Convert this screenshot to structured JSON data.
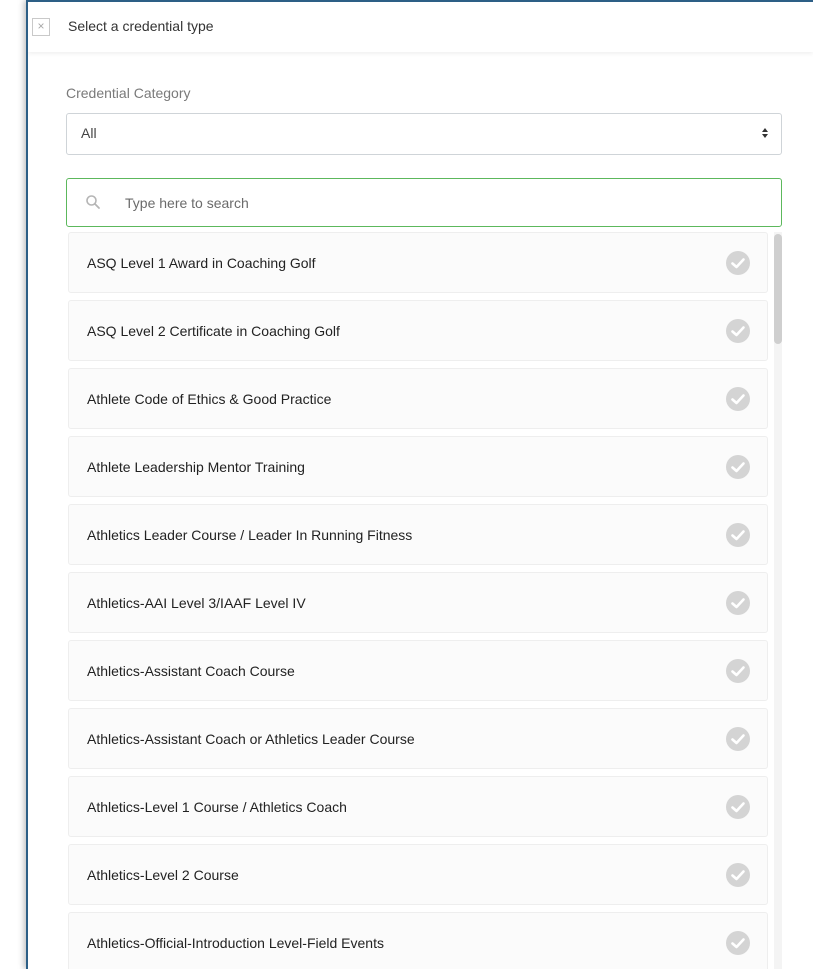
{
  "header": {
    "title": "Select a credential type",
    "close_glyph": "×"
  },
  "category": {
    "label": "Credential Category",
    "selected": "All"
  },
  "search": {
    "placeholder": "Type here to search",
    "value": ""
  },
  "items": [
    {
      "label": "ASQ Level 1 Award in Coaching Golf"
    },
    {
      "label": "ASQ Level 2 Certificate in Coaching Golf"
    },
    {
      "label": "Athlete Code of Ethics & Good Practice"
    },
    {
      "label": "Athlete Leadership Mentor Training"
    },
    {
      "label": "Athletics Leader Course / Leader In Running Fitness"
    },
    {
      "label": "Athletics-AAI Level 3/IAAF Level IV"
    },
    {
      "label": "Athletics-Assistant Coach Course"
    },
    {
      "label": "Athletics-Assistant Coach or Athletics Leader Course"
    },
    {
      "label": "Athletics-Level 1 Course / Athletics Coach"
    },
    {
      "label": "Athletics-Level 2 Course"
    },
    {
      "label": "Athletics-Official-Introduction Level-Field Events"
    }
  ],
  "icons": {
    "close": "close-icon",
    "select_arrows": "sort-arrows-icon",
    "search": "search-icon",
    "check": "check-circle-icon"
  },
  "colors": {
    "modal_border": "#2d5f86",
    "search_border": "#5cb85c",
    "check_fill": "#d4d4d4"
  }
}
